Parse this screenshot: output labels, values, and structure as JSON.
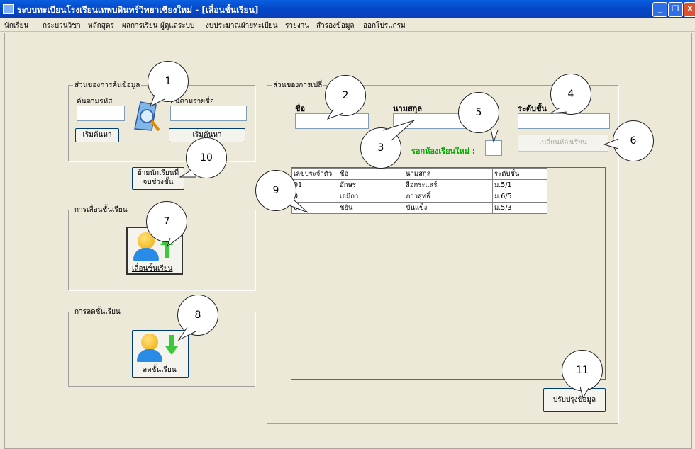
{
  "window": {
    "title": "ระบบทะเบียนโรงเรียนเทพบดินทร์วิทยาเชียงใหม่ - [เลื่อนชั้นเรียน]",
    "min_label": "_",
    "max_label": "❐",
    "close_label": "X"
  },
  "menu": [
    "นักเรียน",
    "กระบวนวิชา",
    "หลักสูตร",
    "ผลการเรียน",
    "ผู้ดูแลระบบ",
    "งบประมาณฝ่ายทะเบียน",
    "รายงาน",
    "สำรองข้อมูล",
    "ออกโปรแกรม"
  ],
  "search": {
    "group_label": "ส่วนของการค้นข้อมูล",
    "by_code_label": "ค้นตามรหัส",
    "by_name_label": "ค้นตามรายชื่อ",
    "search_btn1": "เริ่มค้นหา",
    "search_btn2": "เริ่มค้นหา",
    "code_value": "",
    "name_value": ""
  },
  "move_graduated_btn": "ย้ายนักเรียนที่\nจบช่วงชั้น",
  "promote": {
    "group_label": "การเลื่อนชั้นเรียน",
    "button_label": "เลื่อนชั้นเรียน"
  },
  "demote": {
    "group_label": "การลดชั้นเรียน",
    "button_label": "ลดชั้นเรียน"
  },
  "edit": {
    "group_label": "ส่วนของการเปลี่",
    "first_name_label": "ชื่อ",
    "last_name_label": "นามสกุล",
    "class_label": "ระดับชั้น",
    "new_room_label": "รอกห้องเรียนใหม่ :",
    "change_room_btn": "เปลี่ยนห้องเรียน",
    "update_btn": "ปรับปรุงข้อมูล"
  },
  "table": {
    "headers": [
      "เลขประจำตัว",
      "ชื่อ",
      "นามสกุล",
      "ระดับชั้น"
    ],
    "rows": [
      [
        "01",
        "อักษร",
        "สีอกระแสร์",
        "ม.5/1"
      ],
      [
        "0",
        "เอมิกา",
        "ภาวสุทธิ์",
        "ม.6/5"
      ],
      [
        "02",
        "ชยัน",
        "ขันแข็ง",
        "ม.5/3"
      ]
    ]
  },
  "callouts": [
    "1",
    "2",
    "3",
    "4",
    "5",
    "6",
    "7",
    "8",
    "9",
    "10",
    "11"
  ],
  "colors": {
    "titlebar": "#0a48cc",
    "accent_green": "#00aa00",
    "background": "#ece9d8"
  }
}
